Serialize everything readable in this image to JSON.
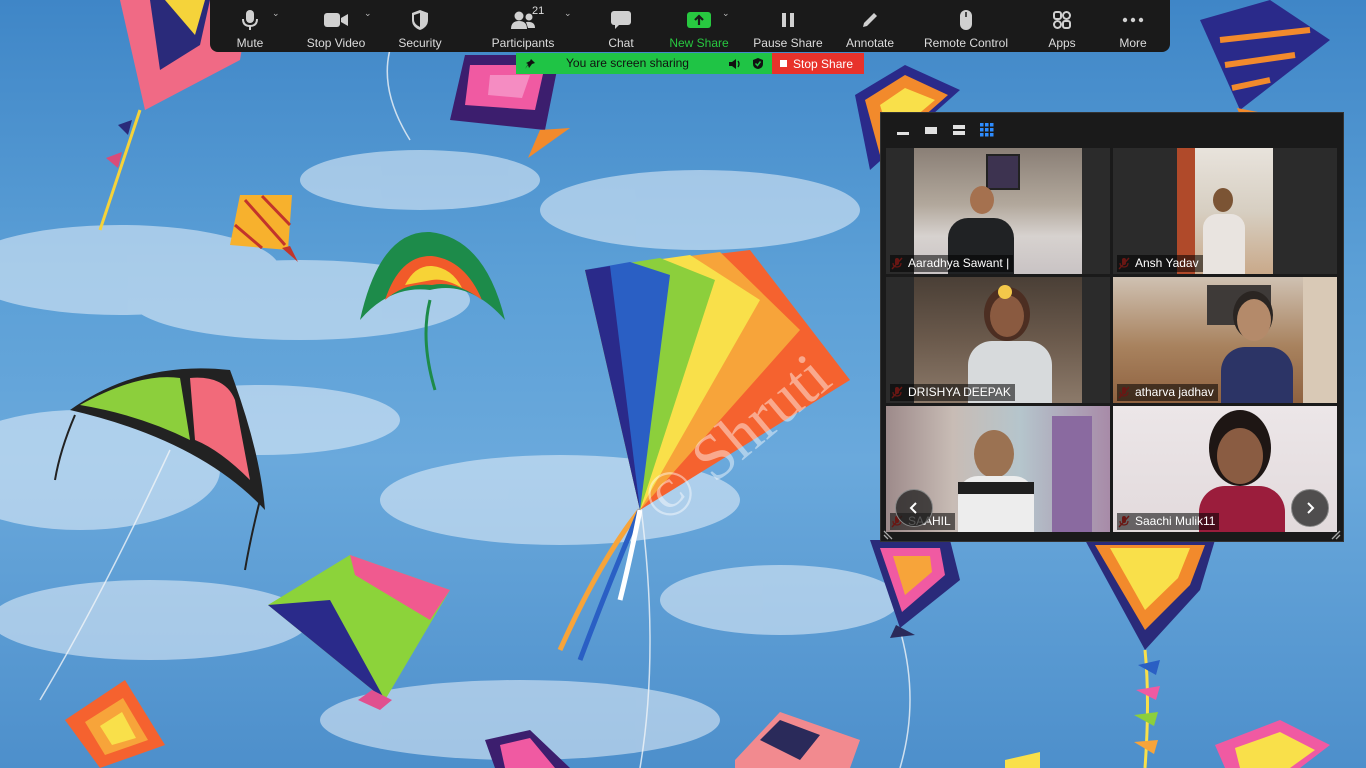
{
  "toolbar": {
    "mute": "Mute",
    "stop_video": "Stop Video",
    "security": "Security",
    "participants": "Participants",
    "participants_count": "21",
    "chat": "Chat",
    "new_share": "New Share",
    "pause_share": "Pause Share",
    "annotate": "Annotate",
    "remote_control": "Remote Control",
    "apps": "Apps",
    "more": "More"
  },
  "share_banner": {
    "text": "You are screen sharing",
    "stop_label": "Stop Share"
  },
  "shared_screen": {
    "watermark": "© Shruti"
  },
  "gallery": {
    "participants": [
      {
        "name": "Aaradhya Sawant |"
      },
      {
        "name": "Ansh  Yadav"
      },
      {
        "name": "DRISHYA DEEPAK"
      },
      {
        "name": "atharva jadhav"
      },
      {
        "name": "SAAHIL"
      },
      {
        "name": "Saachi Mulik11"
      }
    ]
  },
  "colors": {
    "toolbar_bg": "#1a1a1a",
    "share_green": "#1fc445",
    "stop_red": "#e8322b",
    "new_share_green": "#28c840",
    "muted_mic_red": "#e8322b"
  }
}
